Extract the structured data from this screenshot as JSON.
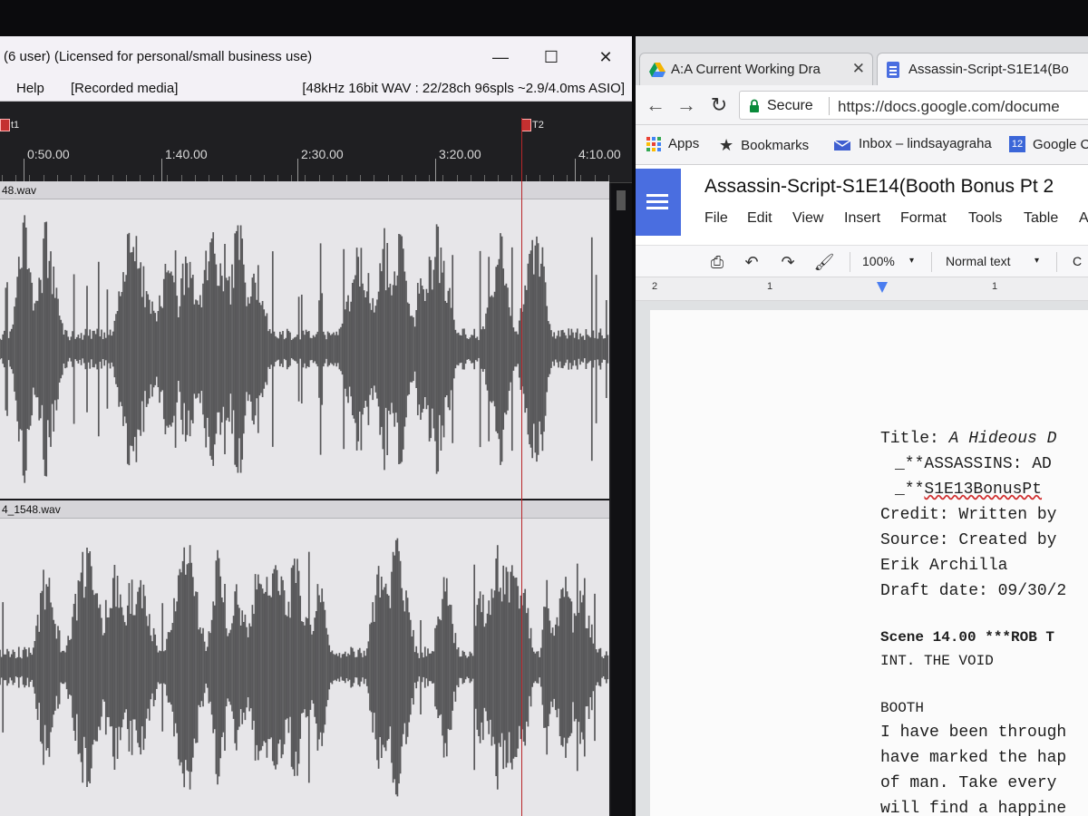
{
  "audio_editor": {
    "title": "(6 user) (Licensed for personal/small business use)",
    "window_controls": {
      "minimize": "—",
      "maximize": "☐",
      "close": "✕"
    },
    "menu": {
      "help": "Help",
      "recorded": "[Recorded media]"
    },
    "status": "[48kHz 16bit WAV : 22/28ch 96spls ~2.9/4.0ms ASIO]",
    "markers": [
      "t1",
      "T2"
    ],
    "ruler_ticks": [
      "0:50.00",
      "1:40.00",
      "2:30.00",
      "3:20.00",
      "4:10.00"
    ],
    "tracks": [
      {
        "name": "48.wav"
      },
      {
        "name": "4_1548.wav"
      }
    ],
    "waveform_color": "#58585a",
    "playhead_color": "#b9262a"
  },
  "browser": {
    "tabs": [
      {
        "label": "A:A Current Working Dra",
        "icon": "drive-icon",
        "close": "✕"
      },
      {
        "label": "Assassin-Script-S1E14(Bo",
        "icon": "docs-icon",
        "close": ""
      }
    ],
    "secure_label": "Secure",
    "url": "https://docs.google.com/docume",
    "bookmarks": [
      {
        "label": "Apps",
        "icon": "apps-grid-icon"
      },
      {
        "label": "Bookmarks",
        "icon": "star-icon"
      },
      {
        "label": "Inbox – lindsayagraha",
        "icon": "inbox-icon"
      },
      {
        "label": "Google C",
        "icon": "calendar-icon",
        "badge": "12"
      }
    ]
  },
  "docs": {
    "title": "Assassin-Script-S1E14(Booth Bonus Pt 2",
    "menu": [
      "File",
      "Edit",
      "View",
      "Insert",
      "Format",
      "Tools",
      "Table",
      "A"
    ],
    "zoom": "100%",
    "style": "Normal text",
    "font_partial": "C",
    "ruler_numbers": [
      "2",
      "1",
      "1"
    ],
    "lines": {
      "title_label": "Title: ",
      "title_value": "A Hideous D",
      "line2": "_**ASSASSINS: AD",
      "line3_prefix": "_**",
      "line3_value": "S1E13BonusPt",
      "credit": "Credit: Written by",
      "source": "Source: Created by",
      "author": "Erik Archilla",
      "draft": "Draft date: 09/30/2",
      "scene": "Scene 14.00 ***ROB T",
      "slug": "INT. THE VOID",
      "character": "BOOTH",
      "dlg1": "I have been through",
      "dlg2": "have marked the hap",
      "dlg3": "of man.  Take every",
      "dlg4": "will find a happine"
    },
    "accent_color": "#4a6ee0"
  }
}
